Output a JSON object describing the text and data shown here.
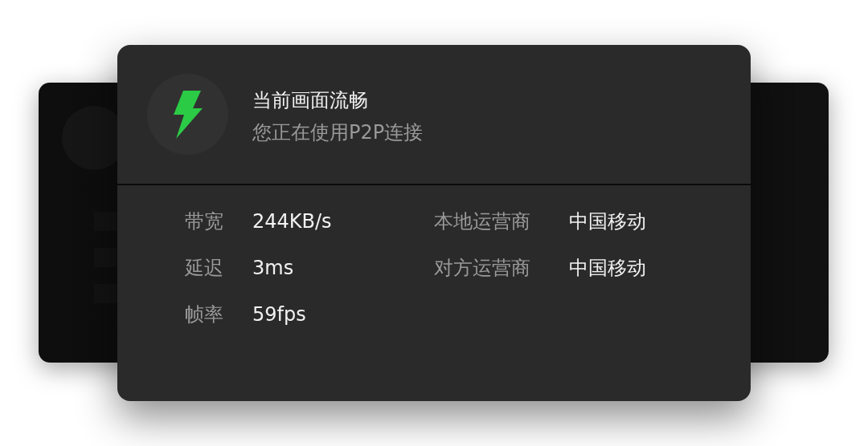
{
  "status": {
    "title": "当前画面流畅",
    "subtitle": "您正在使用P2P连接"
  },
  "stats": [
    {
      "label": "带宽",
      "value": "244KB/s"
    },
    {
      "label": "延迟",
      "value": "3ms"
    },
    {
      "label": "帧率",
      "value": "59fps"
    }
  ],
  "carriers": [
    {
      "label": "本地运营商",
      "value": "中国移动"
    },
    {
      "label": "对方运营商",
      "value": "中国移动"
    }
  ]
}
